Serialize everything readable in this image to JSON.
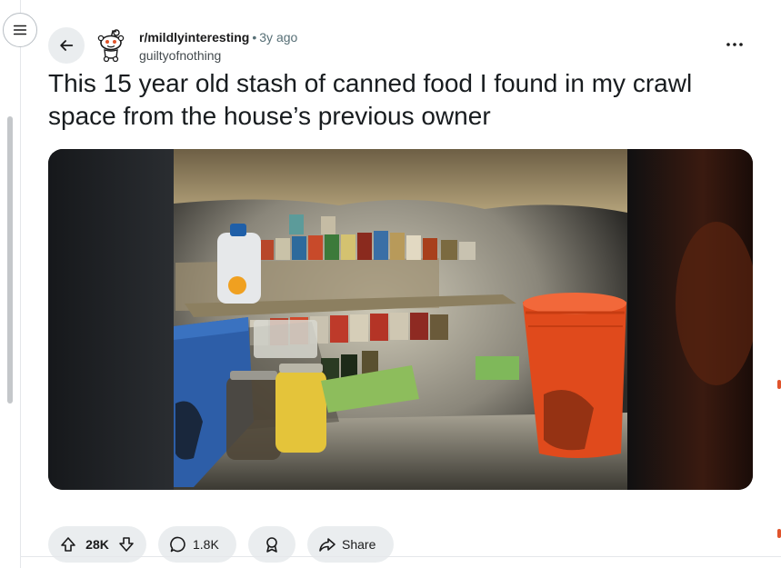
{
  "post": {
    "subreddit": "r/mildlyinteresting",
    "separator": "•",
    "time_ago": "3y ago",
    "author": "guiltyofnothing",
    "title": "This 15 year old stash of canned food I found in my crawl space from the house’s previous owner"
  },
  "actions": {
    "upvote_count": "28K",
    "comment_count": "1.8K",
    "share_label": "Share"
  },
  "icons": {
    "menu": "hamburger-icon",
    "back": "arrow-left-icon",
    "more": "ellipsis-icon",
    "upvote": "arrow-up-icon",
    "downvote": "arrow-down-icon",
    "comment": "speech-bubble-icon",
    "award": "award-icon",
    "share": "share-arrow-icon"
  },
  "colors": {
    "pill_bg": "#eaedef",
    "text": "#1a1a1b",
    "muted": "#576f76",
    "accent": "#e0542c"
  }
}
